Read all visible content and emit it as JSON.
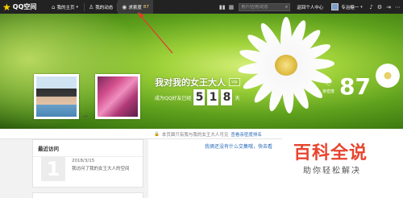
{
  "topbar": {
    "logo_text": "QQ空间",
    "nav": [
      {
        "label": "我的主页",
        "icon": "home-icon"
      },
      {
        "label": "我的动态",
        "icon": "person-icon"
      },
      {
        "label": "求索度",
        "icon": "eye-icon",
        "count": "87"
      }
    ],
    "search_placeholder": "用户/应用/动态",
    "return_link": "返回个人中心",
    "user_name": "专治糖一"
  },
  "banner": {
    "space_title": "我对我的女王大人",
    "vip_badge": "vip",
    "days_label": "成为QQ好友已经",
    "days_digits": [
      "5",
      "1",
      "8"
    ],
    "days_unit": "天",
    "visit_label": "亲密度",
    "visit_count": "87"
  },
  "info_strip": {
    "text": "本页面只有我与我的女王大人可见",
    "link": "查看亲密度排名"
  },
  "recent_visits": {
    "title": "最近访问",
    "items": [
      {
        "day": "1",
        "date": "2018/3/15",
        "desc": "我访问了我的女王大人的空间"
      }
    ]
  },
  "main": {
    "no_exchange_text": "我俩还没有什么交集哦，快去看"
  },
  "watermark": {
    "big": "百科全说",
    "small": "助你轻松解决"
  },
  "colors": {
    "topbar": "#222222",
    "link": "#2a6bb8",
    "watermark_red": "#e8442e"
  }
}
